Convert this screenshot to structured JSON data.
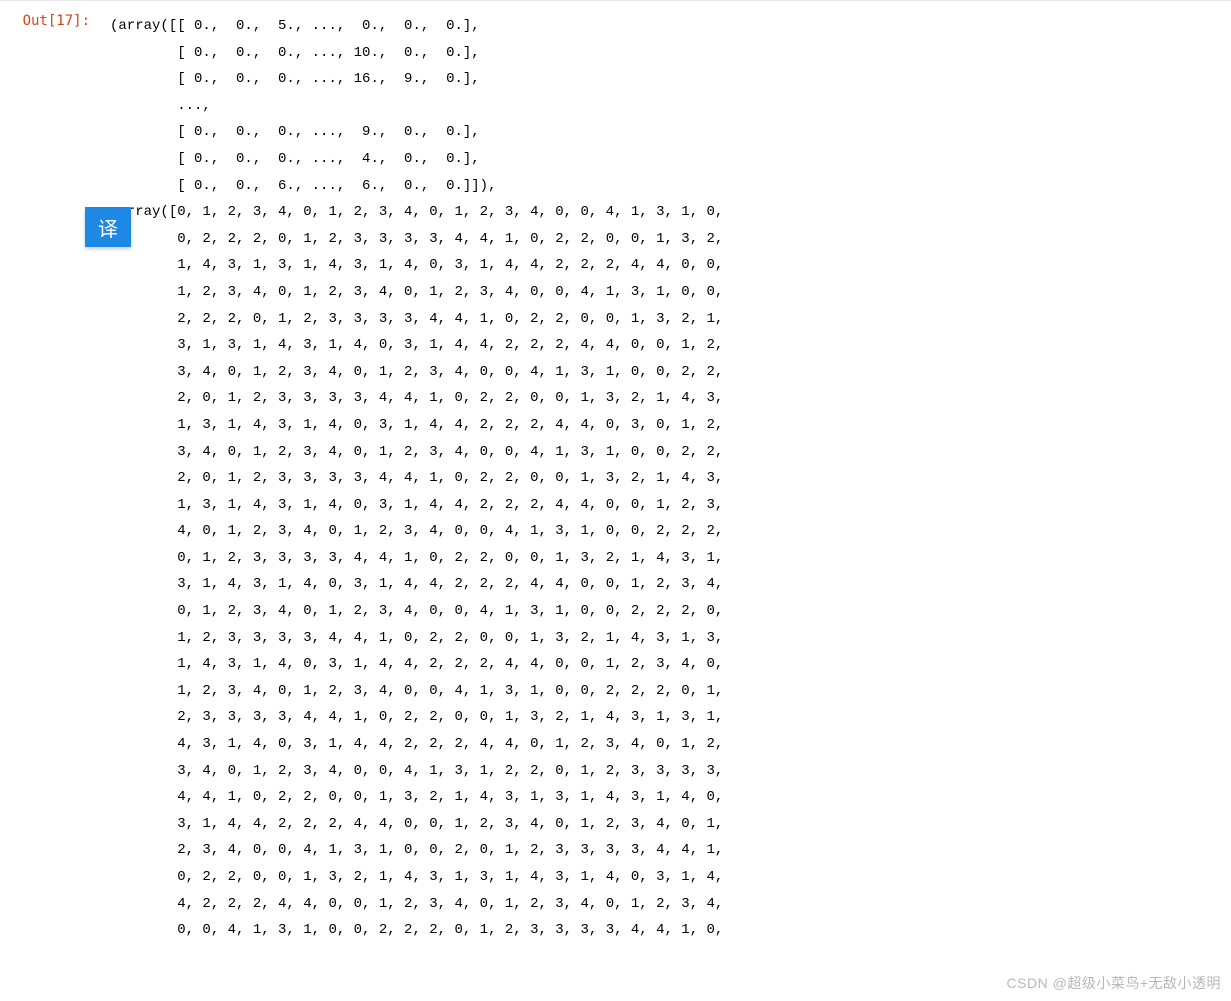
{
  "prompt": {
    "label": "Out[17]:"
  },
  "array1": {
    "rows": [
      "[ 0.,  0.,  5., ...,  0.,  0.,  0.],",
      "[ 0.,  0.,  0., ..., 10.,  0.,  0.],",
      "[ 0.,  0.,  0., ..., 16.,  9.,  0.],",
      "...,",
      "[ 0.,  0.,  0., ...,  9.,  0.,  0.],",
      "[ 0.,  0.,  0., ...,  4.,  0.,  0.],",
      "[ 0.,  0.,  6., ...,  6.,  0.,  0.]]),"
    ]
  },
  "array2": {
    "rows": [
      "array([0, 1, 2, 3, 4, 0, 1, 2, 3, 4, 0, 1, 2, 3, 4, 0, 0, 4, 1, 3, 1, 0,",
      "0, 2, 2, 2, 0, 1, 2, 3, 3, 3, 3, 4, 4, 1, 0, 2, 2, 0, 0, 1, 3, 2,",
      "1, 4, 3, 1, 3, 1, 4, 3, 1, 4, 0, 3, 1, 4, 4, 2, 2, 2, 4, 4, 0, 0,",
      "1, 2, 3, 4, 0, 1, 2, 3, 4, 0, 1, 2, 3, 4, 0, 0, 4, 1, 3, 1, 0, 0,",
      "2, 2, 2, 0, 1, 2, 3, 3, 3, 3, 4, 4, 1, 0, 2, 2, 0, 0, 1, 3, 2, 1,",
      "3, 1, 3, 1, 4, 3, 1, 4, 0, 3, 1, 4, 4, 2, 2, 2, 4, 4, 0, 0, 1, 2,",
      "3, 4, 0, 1, 2, 3, 4, 0, 1, 2, 3, 4, 0, 0, 4, 1, 3, 1, 0, 0, 2, 2,",
      "2, 0, 1, 2, 3, 3, 3, 3, 4, 4, 1, 0, 2, 2, 0, 0, 1, 3, 2, 1, 4, 3,",
      "1, 3, 1, 4, 3, 1, 4, 0, 3, 1, 4, 4, 2, 2, 2, 4, 4, 0, 3, 0, 1, 2,",
      "3, 4, 0, 1, 2, 3, 4, 0, 1, 2, 3, 4, 0, 0, 4, 1, 3, 1, 0, 0, 2, 2,",
      "2, 0, 1, 2, 3, 3, 3, 3, 4, 4, 1, 0, 2, 2, 0, 0, 1, 3, 2, 1, 4, 3,",
      "1, 3, 1, 4, 3, 1, 4, 0, 3, 1, 4, 4, 2, 2, 2, 4, 4, 0, 0, 1, 2, 3,",
      "4, 0, 1, 2, 3, 4, 0, 1, 2, 3, 4, 0, 0, 4, 1, 3, 1, 0, 0, 2, 2, 2,",
      "0, 1, 2, 3, 3, 3, 3, 4, 4, 1, 0, 2, 2, 0, 0, 1, 3, 2, 1, 4, 3, 1,",
      "3, 1, 4, 3, 1, 4, 0, 3, 1, 4, 4, 2, 2, 2, 4, 4, 0, 0, 1, 2, 3, 4,",
      "0, 1, 2, 3, 4, 0, 1, 2, 3, 4, 0, 0, 4, 1, 3, 1, 0, 0, 2, 2, 2, 0,",
      "1, 2, 3, 3, 3, 3, 4, 4, 1, 0, 2, 2, 0, 0, 1, 3, 2, 1, 4, 3, 1, 3,",
      "1, 4, 3, 1, 4, 0, 3, 1, 4, 4, 2, 2, 2, 4, 4, 0, 0, 1, 2, 3, 4, 0,",
      "1, 2, 3, 4, 0, 1, 2, 3, 4, 0, 0, 4, 1, 3, 1, 0, 0, 2, 2, 2, 0, 1,",
      "2, 3, 3, 3, 3, 4, 4, 1, 0, 2, 2, 0, 0, 1, 3, 2, 1, 4, 3, 1, 3, 1,",
      "4, 3, 1, 4, 0, 3, 1, 4, 4, 2, 2, 2, 4, 4, 0, 1, 2, 3, 4, 0, 1, 2,",
      "3, 4, 0, 1, 2, 3, 4, 0, 0, 4, 1, 3, 1, 2, 2, 0, 1, 2, 3, 3, 3, 3,",
      "4, 4, 1, 0, 2, 2, 0, 0, 1, 3, 2, 1, 4, 3, 1, 3, 1, 4, 3, 1, 4, 0,",
      "3, 1, 4, 4, 2, 2, 2, 4, 4, 0, 0, 1, 2, 3, 4, 0, 1, 2, 3, 4, 0, 1,",
      "2, 3, 4, 0, 0, 4, 1, 3, 1, 0, 0, 2, 0, 1, 2, 3, 3, 3, 3, 4, 4, 1,",
      "0, 2, 2, 0, 0, 1, 3, 2, 1, 4, 3, 1, 3, 1, 4, 3, 1, 4, 0, 3, 1, 4,",
      "4, 2, 2, 2, 4, 4, 0, 0, 1, 2, 3, 4, 0, 1, 2, 3, 4, 0, 1, 2, 3, 4,",
      "0, 0, 4, 1, 3, 1, 0, 0, 2, 2, 2, 0, 1, 2, 3, 3, 3, 3, 4, 4, 1, 0,"
    ]
  },
  "translate": {
    "label": "译"
  },
  "watermark": {
    "text": "CSDN @超级小菜鸟+无敌小透明"
  }
}
